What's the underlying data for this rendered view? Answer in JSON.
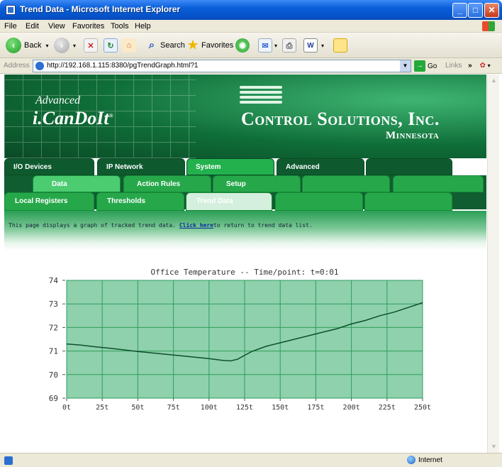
{
  "window": {
    "title": "Trend Data - Microsoft Internet Explorer",
    "minimize": "_",
    "maximize": "□",
    "close": "✕"
  },
  "menu": [
    "File",
    "Edit",
    "View",
    "Favorites",
    "Tools",
    "Help"
  ],
  "toolbar": {
    "back_label": "Back",
    "search_label": "Search",
    "favorites_label": "Favorites"
  },
  "address": {
    "label": "Address",
    "url": "http://192.168.1.115:8380/pgTrendGraph.html?1",
    "go_label": "Go",
    "links_label": "Links"
  },
  "banner": {
    "advanced": "Advanced",
    "brand": "i.CanDoIt",
    "company": "Control Solutions, Inc.",
    "state": "Minnesota"
  },
  "tabs": {
    "row1": [
      "I/O Devices",
      "IP Network",
      "System",
      "Advanced",
      ""
    ],
    "row1_active": "System",
    "row2": [
      "Data",
      "Action Rules",
      "Setup",
      "",
      ""
    ],
    "row2_active": "Data",
    "row3": [
      "Local Registers",
      "Thresholds",
      "Trend Data",
      "",
      ""
    ],
    "row3_active": "Trend Data"
  },
  "info": {
    "text_before": "This page displays a graph of tracked trend data. ",
    "link": "Click here",
    "text_after": "to return to trend data list."
  },
  "chart_data": {
    "type": "line",
    "title": "Office Temperature -- Time/point: t=0:01",
    "xlabel": "",
    "ylabel": "",
    "x_ticks": [
      "0t",
      "25t",
      "50t",
      "75t",
      "100t",
      "125t",
      "150t",
      "175t",
      "200t",
      "225t",
      "250t"
    ],
    "y_ticks": [
      74,
      73,
      72,
      71,
      70,
      69
    ],
    "xlim": [
      0,
      250
    ],
    "ylim": [
      69,
      74
    ],
    "grid": true,
    "series": [
      {
        "x": [
          0,
          10,
          20,
          30,
          40,
          50,
          60,
          70,
          80,
          90,
          100,
          110,
          115,
          120,
          125,
          130,
          140,
          150,
          160,
          170,
          180,
          190,
          200,
          210,
          220,
          230,
          240,
          250
        ],
        "values": [
          71.3,
          71.25,
          71.18,
          71.12,
          71.05,
          70.98,
          70.92,
          70.86,
          70.8,
          70.74,
          70.68,
          70.6,
          70.58,
          70.65,
          70.82,
          70.98,
          71.2,
          71.35,
          71.5,
          71.65,
          71.8,
          71.95,
          72.15,
          72.3,
          72.5,
          72.65,
          72.85,
          73.05
        ]
      }
    ],
    "colors": {
      "plot_bg": "#8fd0ad",
      "grid": "#2f9e5a",
      "line": "#0f4f2c"
    }
  },
  "status": {
    "zone": "Internet"
  }
}
